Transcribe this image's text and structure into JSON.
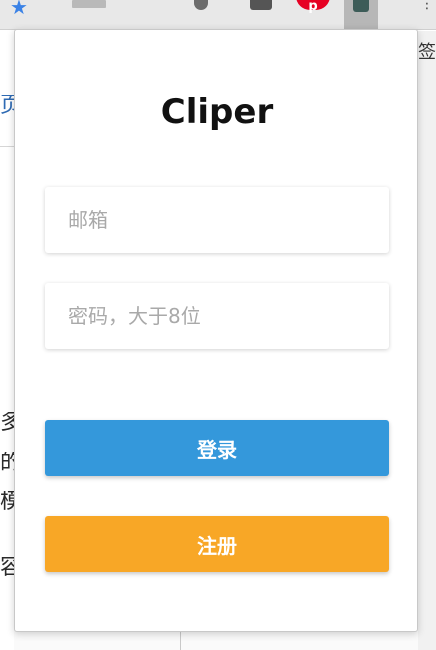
{
  "browser": {
    "toolbar_icons": [
      "bookmark-star-icon",
      "thumbnail-icon",
      "shield-icon",
      "person-icon",
      "pinterest-icon",
      "extension-icon",
      "more-icon"
    ],
    "pinterest_glyph": "p",
    "star_glyph": "★",
    "more_glyph": "⋮"
  },
  "background": {
    "left_chars": [
      "页",
      "多",
      "的",
      "模",
      "容"
    ],
    "right_char": "签"
  },
  "popup": {
    "title": "Cliper",
    "email_placeholder": "邮箱",
    "password_placeholder": "密码，大于8位",
    "login_label": "登录",
    "register_label": "注册",
    "colors": {
      "login_button": "#3498db",
      "register_button": "#f8a726"
    }
  }
}
